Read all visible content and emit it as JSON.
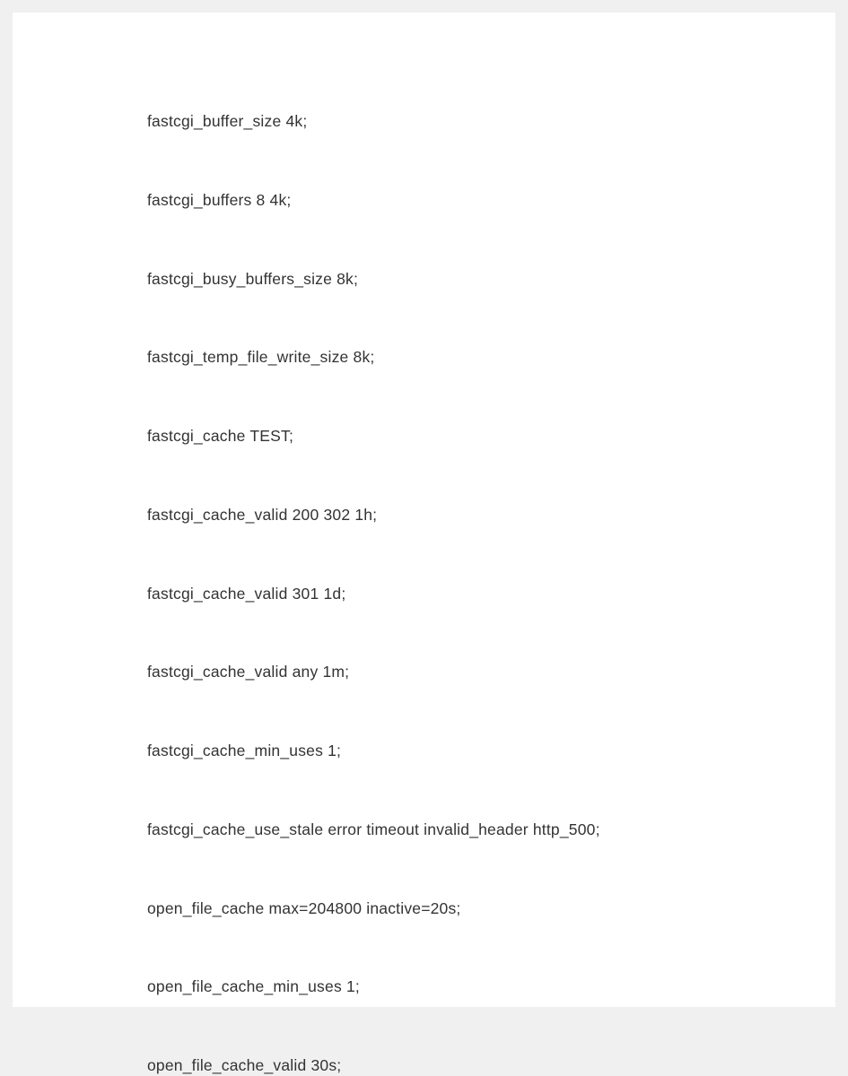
{
  "lines": [
    "fastcgi_buffer_size 4k;",
    "fastcgi_buffers 8 4k;",
    "fastcgi_busy_buffers_size 8k;",
    "fastcgi_temp_file_write_size 8k;",
    "fastcgi_cache TEST;",
    "fastcgi_cache_valid 200 302 1h;",
    "fastcgi_cache_valid 301 1d;",
    "fastcgi_cache_valid any 1m;",
    "fastcgi_cache_min_uses 1;",
    "fastcgi_cache_use_stale error timeout invalid_header http_500;",
    "open_file_cache max=204800 inactive=20s;",
    "open_file_cache_min_uses 1;",
    "open_file_cache_valid 30s;"
  ]
}
